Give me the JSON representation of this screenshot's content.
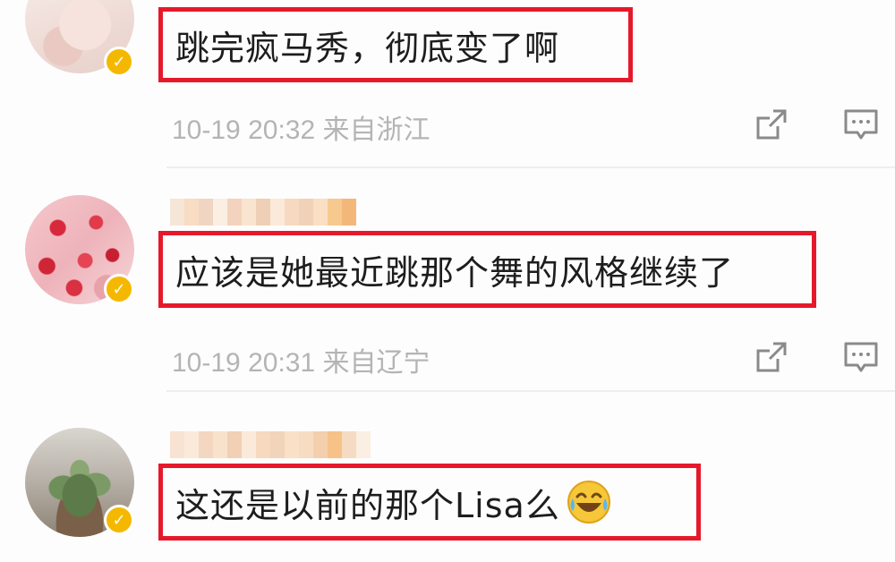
{
  "comments": [
    {
      "text": "跳完疯马秀，彻底变了啊",
      "date": "10-19",
      "time": "20:32",
      "location": "来自浙江",
      "verified_badge": "✓"
    },
    {
      "text": "应该是她最近跳那个舞的风格继续了",
      "date": "10-19",
      "time": "20:31",
      "location": "来自辽宁",
      "verified_badge": "✓"
    },
    {
      "text": "这还是以前的那个Lisa么",
      "emoji": "laughing-crying-emoji",
      "verified_badge": "✓"
    }
  ],
  "icons": {
    "share": "share-icon",
    "reply": "comment-icon"
  },
  "colors": {
    "highlight_border": "#e6192b",
    "verified_badge": "#f5b800",
    "meta_text": "#b4b4b4",
    "comment_text": "#1d1d1d"
  }
}
